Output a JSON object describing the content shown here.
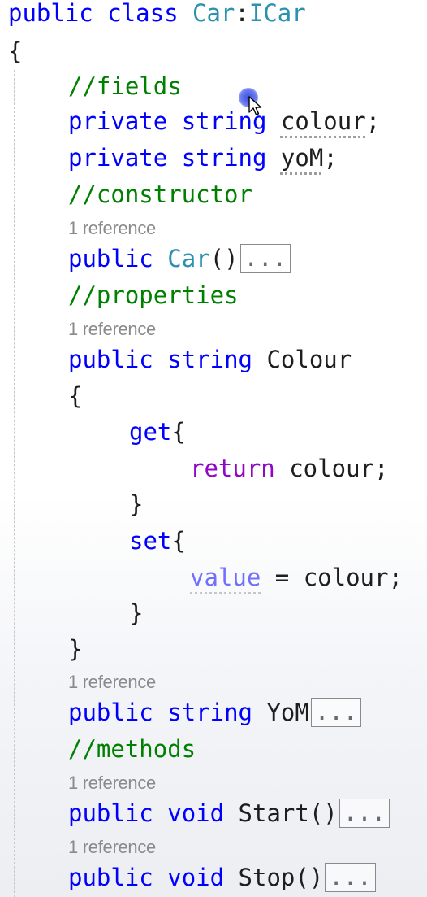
{
  "code": {
    "class_decl": {
      "kw": "public",
      "kw2": "class",
      "name": "Car",
      "colon": ":",
      "iface": "ICar"
    },
    "open_brace": "{",
    "fields_comment": "//fields",
    "field_colour": {
      "kw": "private",
      "type": "string",
      "name": "colour",
      "end": ";"
    },
    "field_yom": {
      "kw": "private",
      "type": "string",
      "name": "yoM",
      "end": ";"
    },
    "constructor_comment": "//constructor",
    "ref_constructor": "1 reference",
    "ctor": {
      "kw": "public",
      "name": "Car",
      "parens": "()",
      "collapsed": "..."
    },
    "properties_comment": "//properties",
    "ref_colour": "1 reference",
    "prop_colour": {
      "kw": "public",
      "type": "string",
      "name": "Colour"
    },
    "prop_open": "{",
    "get_line": {
      "kw": "get",
      "brace": "{"
    },
    "return_line": {
      "kw": "return",
      "rest": " colour;"
    },
    "get_close": "}",
    "set_line": {
      "kw": "set",
      "brace": "{"
    },
    "value_line": {
      "kw": "value",
      "rest": " = colour;"
    },
    "set_close": "}",
    "prop_close": "}",
    "ref_yom": "1 reference",
    "prop_yom": {
      "kw": "public",
      "type": "string",
      "name": "YoM",
      "collapsed": "..."
    },
    "methods_comment": "//methods",
    "ref_start": "1 reference",
    "start": {
      "kw": "public",
      "type": "void",
      "name": "Start()",
      "collapsed": "..."
    },
    "ref_stop": "1 reference",
    "stop": {
      "kw": "public",
      "type": "void",
      "name": "Stop()",
      "collapsed": "..."
    }
  },
  "colors": {
    "keyword": "#0000ff",
    "type": "#2b91af",
    "comment": "#008000",
    "control": "#8f08c4",
    "text": "#1e1e1e",
    "codelens": "#8a8a8a"
  },
  "icons": {
    "pointer": "mouse-pointer-icon"
  }
}
